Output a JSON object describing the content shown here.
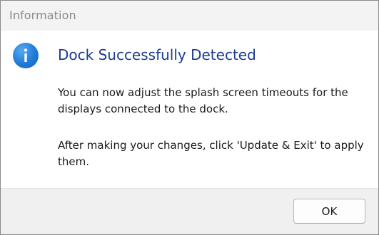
{
  "window": {
    "title": "Information"
  },
  "dialog": {
    "icon": "info-icon",
    "heading": "Dock Successfully Detected",
    "paragraphs": [
      "You can now adjust the splash screen timeouts for the displays connected to the dock.",
      "After making your changes, click 'Update & Exit' to apply them."
    ]
  },
  "footer": {
    "ok_label": "OK"
  },
  "colors": {
    "heading": "#1a3d8f",
    "icon": "#1f7ad8",
    "footer_bg": "#f0f0f0"
  }
}
